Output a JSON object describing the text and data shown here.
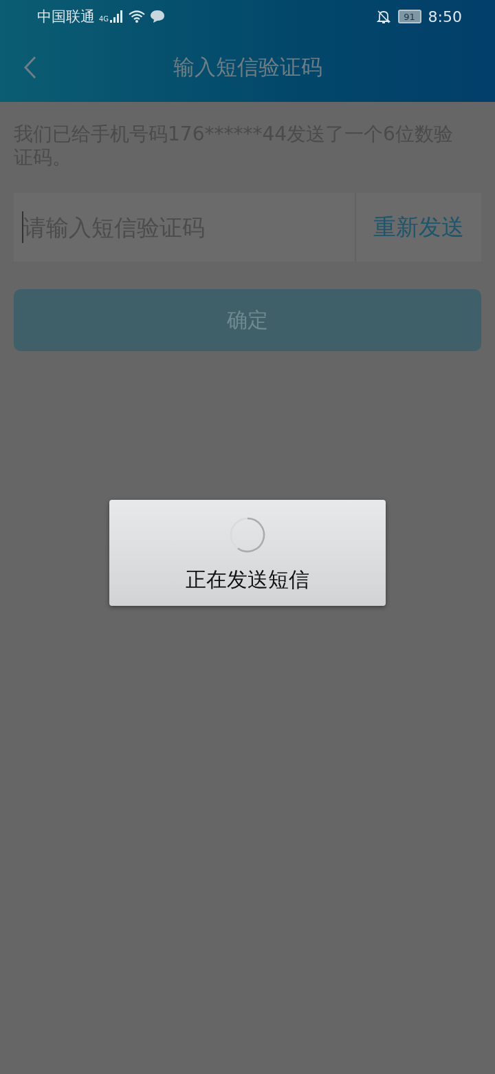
{
  "status_bar": {
    "carrier": "中国联通",
    "network": "4G",
    "battery": "91",
    "time": "8:50"
  },
  "header": {
    "title": "输入短信验证码"
  },
  "message": "我们已给手机号码176******44发送了一个6位数验证码。",
  "code_field": {
    "placeholder": "请输入短信验证码"
  },
  "resend_button": {
    "label": "重新发送"
  },
  "confirm_button": {
    "label": "确定",
    "disabled": true
  },
  "dialog": {
    "message": "正在发送短信"
  }
}
